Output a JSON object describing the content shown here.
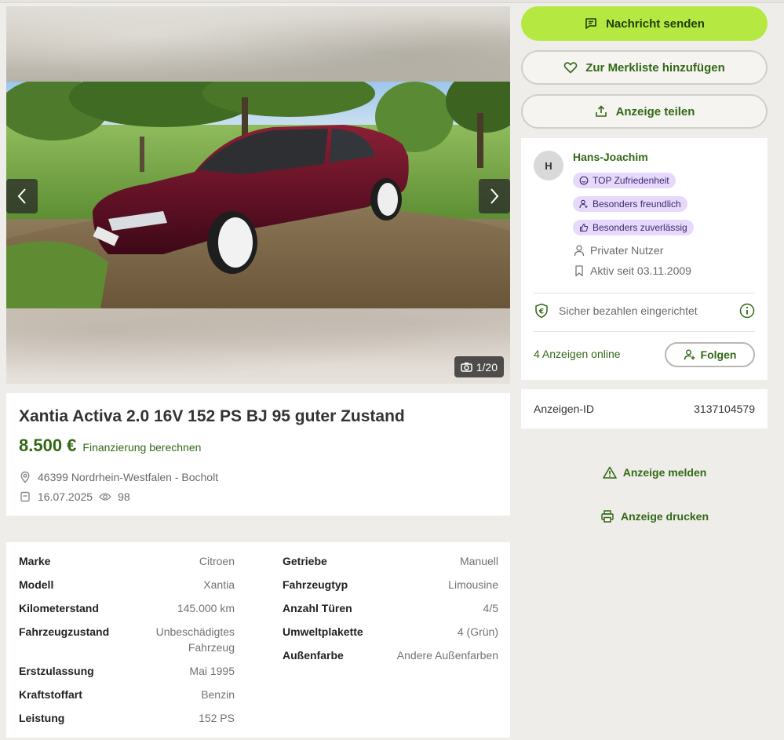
{
  "gallery": {
    "counter": "1/20"
  },
  "listing": {
    "title": "Xantia Activa 2.0 16V 152 PS BJ 95 guter Zustand",
    "price": "8.500 €",
    "financing_link": "Finanzierung berechnen",
    "location": "46399 Nordrhein-Westfalen - Bocholt",
    "date": "16.07.2025",
    "views": "98"
  },
  "details": {
    "left": [
      {
        "key": "Marke",
        "value": "Citroen"
      },
      {
        "key": "Modell",
        "value": "Xantia"
      },
      {
        "key": "Kilometerstand",
        "value": "145.000 km"
      },
      {
        "key": "Fahrzeugzustand",
        "value": "Unbeschädigtes Fahrzeug"
      },
      {
        "key": "Erstzulassung",
        "value": "Mai 1995"
      },
      {
        "key": "Kraftstoffart",
        "value": "Benzin"
      },
      {
        "key": "Leistung",
        "value": "152 PS"
      }
    ],
    "right": [
      {
        "key": "Getriebe",
        "value": "Manuell"
      },
      {
        "key": "Fahrzeugtyp",
        "value": "Limousine"
      },
      {
        "key": "Anzahl Türen",
        "value": "4/5"
      },
      {
        "key": "Umweltplakette",
        "value": "4 (Grün)"
      },
      {
        "key": "Außenfarbe",
        "value": "Andere Außenfarben"
      }
    ]
  },
  "actions": {
    "message": "Nachricht senden",
    "watchlist": "Zur Merkliste hinzufügen",
    "share": "Anzeige teilen",
    "report": "Anzeige melden",
    "print": "Anzeige drucken"
  },
  "seller": {
    "initial": "H",
    "name": "Hans-Joachim",
    "badges": [
      "TOP Zufriedenheit",
      "Besonders freundlich",
      "Besonders zuverlässig"
    ],
    "type": "Privater Nutzer",
    "active_since": "Aktiv seit 03.11.2009",
    "secure_payment": "Sicher bezahlen eingerichtet",
    "ads_online": "4 Anzeigen online",
    "follow": "Folgen"
  },
  "ad_id": {
    "label": "Anzeigen-ID",
    "value": "3137104579"
  },
  "colors": {
    "accent_green": "#326916",
    "primary_button": "#b5e941",
    "badge_bg": "#e6d9fb"
  }
}
